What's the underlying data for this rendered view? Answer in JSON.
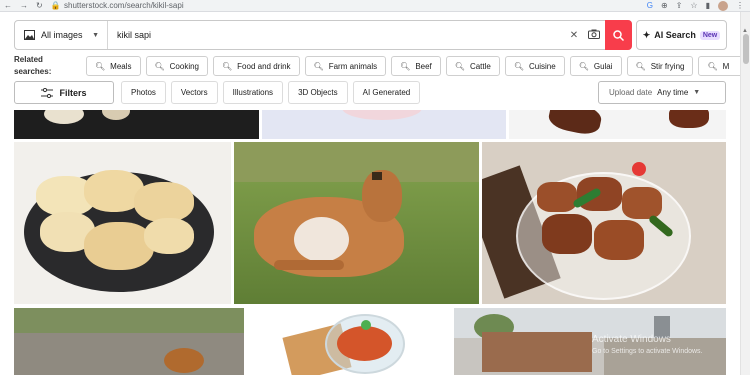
{
  "browser": {
    "url": "shutterstock.com/search/kikil-sapi"
  },
  "search": {
    "type_label": "All images",
    "query": "kikil sapi",
    "ai_label": "AI Search",
    "ai_badge": "New"
  },
  "related": {
    "label_line1": "Related",
    "label_line2": "searches:",
    "items": [
      "Meals",
      "Cooking",
      "Food and drink",
      "Farm animals",
      "Beef",
      "Cattle",
      "Cuisine",
      "Gulai",
      "Stir frying",
      "M"
    ]
  },
  "filters": {
    "label": "Filters",
    "tabs": [
      "Photos",
      "Vectors",
      "Illustrations",
      "3D Objects",
      "AI Generated"
    ],
    "upload_label": "Upload date",
    "upload_value": "Any time"
  },
  "watermark": {
    "line1": "Activate Windows",
    "line2": "Go to Settings to activate Windows."
  },
  "colors": {
    "accent": "#f83d4b",
    "badge_bg": "#e8dcff"
  }
}
